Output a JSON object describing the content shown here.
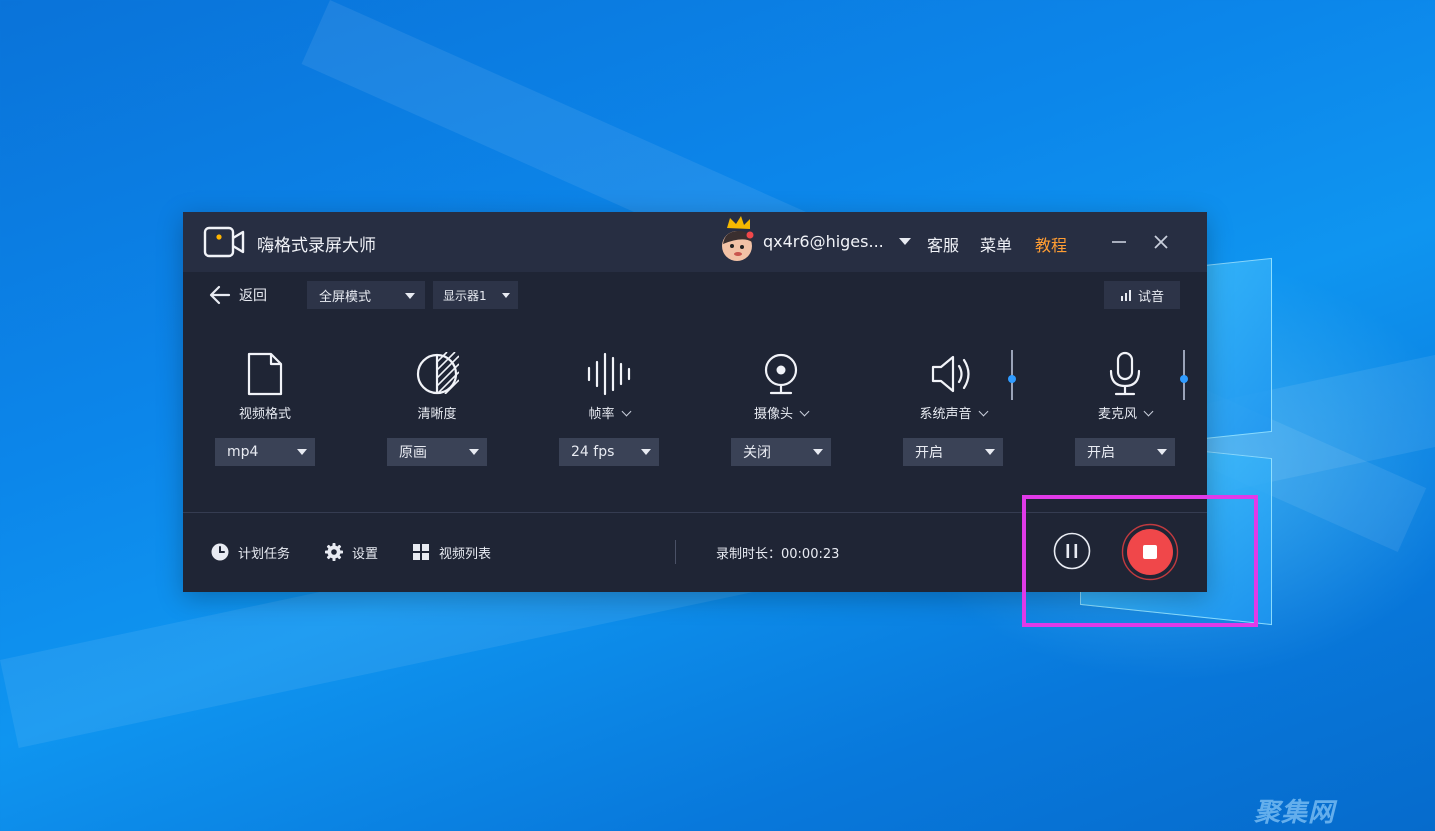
{
  "app": {
    "title": "嗨格式录屏大师",
    "user": "qx4r6@higes...",
    "links": {
      "service": "客服",
      "menu": "菜单",
      "tutorial": "教程"
    },
    "colors": {
      "window_bg": "#1f2535",
      "titlebar_bg": "#272e42",
      "accent": "#ff9d33",
      "record": "#f0474a",
      "highlight": "#e03ae8"
    }
  },
  "toolbar": {
    "back_label": "返回",
    "mode": "全屏模式",
    "display": "显示器1",
    "test_audio": "试音"
  },
  "options": [
    {
      "icon": "file-icon",
      "label": "视频格式",
      "value": "mp4",
      "has_menu": false
    },
    {
      "icon": "clarity-icon",
      "label": "清晰度",
      "value": "原画",
      "has_menu": false
    },
    {
      "icon": "waveform-icon",
      "label": "帧率",
      "value": "24 fps",
      "has_menu": true
    },
    {
      "icon": "webcam-icon",
      "label": "摄像头",
      "value": "关闭",
      "has_menu": true
    },
    {
      "icon": "speaker-icon",
      "label": "系统声音",
      "value": "开启",
      "has_menu": true
    },
    {
      "icon": "microphone-icon",
      "label": "麦克风",
      "value": "开启",
      "has_menu": true
    }
  ],
  "bottom": {
    "schedule": "计划任务",
    "settings": "设置",
    "video_list": "视频列表",
    "record_time": "录制时长：00:00:23"
  },
  "watermark": "聚集网"
}
